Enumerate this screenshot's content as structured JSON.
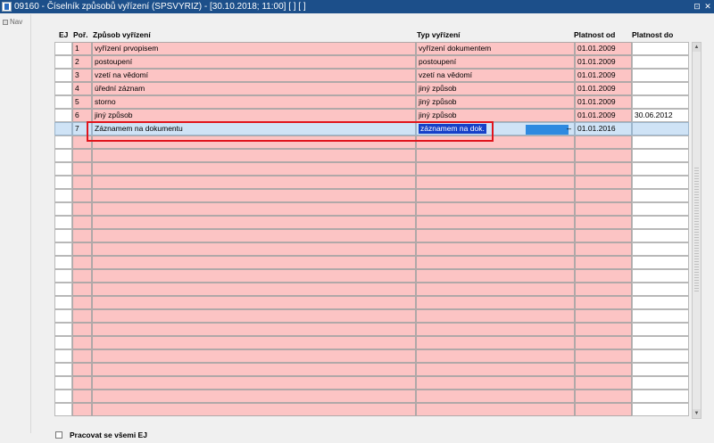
{
  "window": {
    "title": "09160 - Číselník způsobů vyřízení (SPSVYRIZ) - [30.10.2018; 11:00]  [ ] [ ]",
    "restore_glyph": "⊡",
    "close_glyph": "✕"
  },
  "nav": {
    "label": "Nav"
  },
  "columns": {
    "ej": "EJ",
    "por": "Poř.",
    "zpusob": "Způsob vyřízení",
    "typ": "Typ vyřízení",
    "platnost_od": "Platnost od",
    "platnost_do": "Platnost do"
  },
  "rows": [
    {
      "ej": "",
      "por": "1",
      "zpusob": "vyřízení prvopisem",
      "typ": "vyřízení dokumentem",
      "od": "01.01.2009",
      "do": ""
    },
    {
      "ej": "",
      "por": "2",
      "zpusob": "postoupení",
      "typ": "postoupení",
      "od": "01.01.2009",
      "do": ""
    },
    {
      "ej": "",
      "por": "3",
      "zpusob": "vzetí na vědomí",
      "typ": "vzetí na vědomí",
      "od": "01.01.2009",
      "do": ""
    },
    {
      "ej": "",
      "por": "4",
      "zpusob": "úřední záznam",
      "typ": "jiný způsob",
      "od": "01.01.2009",
      "do": ""
    },
    {
      "ej": "",
      "por": "5",
      "zpusob": "storno",
      "typ": "jiný způsob",
      "od": "01.01.2009",
      "do": ""
    },
    {
      "ej": "",
      "por": "6",
      "zpusob": "jiný způsob",
      "typ": "jiný způsob",
      "od": "01.01.2009",
      "do": "30.06.2012"
    },
    {
      "ej": "",
      "por": "7",
      "zpusob": "Záznamem na dokumentu",
      "typ": "záznamem na dok.",
      "od": "01.01.2016",
      "do": "",
      "current": true
    }
  ],
  "empty_row_count": 21,
  "lov_glyph": "–",
  "footer": {
    "checkbox_label": "Pracovat se všemi EJ",
    "checked": false
  },
  "colors": {
    "title_bar": "#1c4f8a",
    "cell_pink": "#fcc4c4",
    "current_row": "#cfe3f6",
    "selection": "#1540c8",
    "focus_outline": "#e0141c"
  }
}
